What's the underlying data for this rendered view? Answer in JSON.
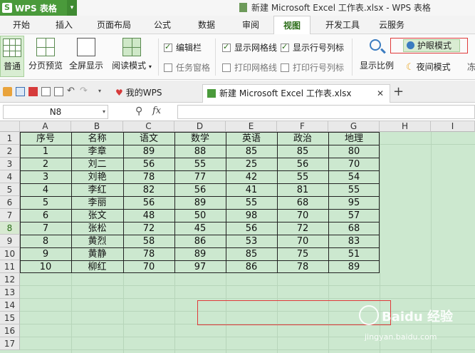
{
  "app": {
    "logo_text": "WPS 表格",
    "window_title": "新建 Microsoft Excel 工作表.xlsx - WPS 表格"
  },
  "menu_tabs": [
    {
      "label": "开始"
    },
    {
      "label": "插入"
    },
    {
      "label": "页面布局"
    },
    {
      "label": "公式"
    },
    {
      "label": "数据"
    },
    {
      "label": "审阅"
    },
    {
      "label": "视图"
    },
    {
      "label": "开发工具"
    },
    {
      "label": "云服务"
    }
  ],
  "ribbon": {
    "normal": "普通",
    "page_break": "分页预览",
    "fullscreen": "全屏显示",
    "reading": "阅读模式",
    "formula_bar": "编辑栏",
    "show_grid": "显示网格线",
    "show_headers": "显示行号列标",
    "task_pane": "任务窗格",
    "print_grid": "打印网格线",
    "print_headers": "打印行号列标",
    "zoom": "显示比例",
    "eye_care": "护眼模式",
    "night": "夜间模式",
    "more": "冻"
  },
  "doc_tabs": {
    "home": "我的WPS",
    "file": "新建 Microsoft Excel 工作表.xlsx"
  },
  "formula_bar": {
    "cell_ref": "N8",
    "fx": "fx"
  },
  "sheet": {
    "columns": [
      "A",
      "B",
      "C",
      "D",
      "E",
      "F",
      "G",
      "H",
      "I"
    ],
    "row_numbers": [
      "1",
      "2",
      "3",
      "4",
      "5",
      "6",
      "7",
      "8",
      "9",
      "10",
      "11",
      "12",
      "13",
      "14",
      "15",
      "16",
      "17"
    ],
    "headers": [
      "序号",
      "名称",
      "语文",
      "数学",
      "英语",
      "政治",
      "地理"
    ],
    "rows": [
      [
        "1",
        "李章",
        "89",
        "88",
        "85",
        "85",
        "80"
      ],
      [
        "2",
        "刘二",
        "56",
        "55",
        "25",
        "56",
        "70"
      ],
      [
        "3",
        "刘艳",
        "78",
        "77",
        "42",
        "55",
        "54"
      ],
      [
        "4",
        "李红",
        "82",
        "56",
        "41",
        "81",
        "55"
      ],
      [
        "5",
        "李丽",
        "56",
        "89",
        "55",
        "68",
        "95"
      ],
      [
        "6",
        "张文",
        "48",
        "50",
        "98",
        "70",
        "57"
      ],
      [
        "7",
        "张松",
        "72",
        "45",
        "56",
        "72",
        "68"
      ],
      [
        "8",
        "黄烈",
        "58",
        "86",
        "53",
        "70",
        "83"
      ],
      [
        "9",
        "黄静",
        "78",
        "89",
        "85",
        "75",
        "51"
      ],
      [
        "10",
        "柳红",
        "70",
        "97",
        "86",
        "78",
        "89"
      ]
    ]
  },
  "watermark": {
    "line1": "Baidu 经验",
    "line2": "jingyan.baidu.com"
  },
  "colors": {
    "accent": "#4a9a3b",
    "eye_care_bg": "#cce8cf",
    "highlight": "#e03a3a"
  }
}
